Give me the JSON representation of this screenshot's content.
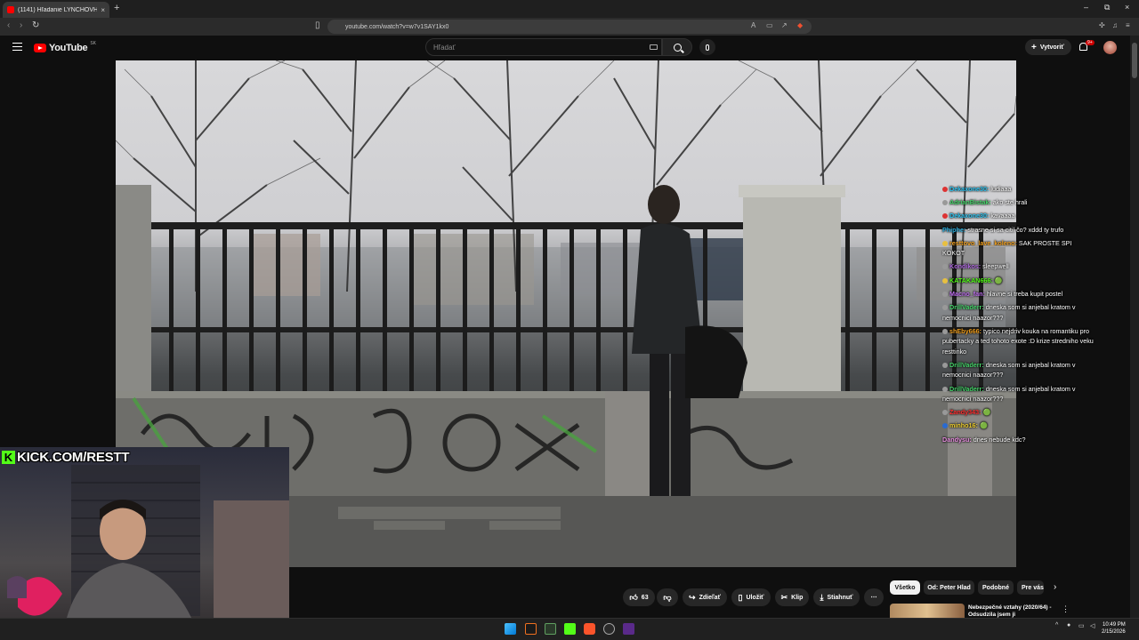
{
  "browser": {
    "tab_title": "(1141) Hľadanie LYNCHOVHO",
    "tab_close": "×",
    "new_tab": "+",
    "url": "youtube.com/watch?v=w7v1SAY1kx0",
    "window_controls": [
      "–",
      "⧉",
      "×"
    ]
  },
  "youtube": {
    "logo_text": "YouTube",
    "country_code": "SK",
    "search_placeholder": "Hľadať",
    "create_label": "Vytvoriť",
    "notif_badge": "9+"
  },
  "chat": [
    {
      "user": "Dekaxone30:",
      "text": "ludiaaa",
      "color": "#2ec4f1",
      "badge": "#d33"
    },
    {
      "user": "AdrianBistak:",
      "text": "ako ste hrali",
      "color": "#46d46a",
      "badge": "#999"
    },
    {
      "user": "Dekaxone30:",
      "text": "kavaaaa",
      "color": "#2ec4f1",
      "badge": "#d33"
    },
    {
      "user": "Phiphe:",
      "text": "strasne si sa citil čo? xddd ty trufo",
      "color": "#30b0e0",
      "badge": ""
    },
    {
      "user": "resttovo_lave_koleno:",
      "text": "SAK PROSTE SPI KOKOT",
      "color": "#f0a020",
      "badge": "#e8c040"
    },
    {
      "user": "Kondikos:",
      "text": "sleepwell",
      "color": "#b06ae0",
      "badge": "#999"
    },
    {
      "user": "KATAKAN666:",
      "text": "🟢",
      "color": "#53fc18",
      "badge": "#e8c040"
    },
    {
      "user": "Macno_fan:",
      "text": "hlavne si treba kupit postel",
      "color": "#c070f0",
      "badge": "#999"
    },
    {
      "user": "DrillVaderr:",
      "text": "dneska som si anjebal kratom v nemocnici naazor???",
      "color": "#46d46a",
      "badge": "#999"
    },
    {
      "user": "shEby666:",
      "text": "typico nejdriv kouka na romantiku pro pubertacky a ted tohoto exote :D krize stredniho veku resttinko",
      "color": "#f0a020",
      "badge": "#999"
    },
    {
      "user": "DrillVaderr:",
      "text": "dneska som si anjebal kratom v nemocnici naazor???",
      "color": "#46d46a",
      "badge": "#999"
    },
    {
      "user": "DrillVaderr:",
      "text": "dneska som si anjebal kratom v nemocnici naazor???",
      "color": "#46d46a",
      "badge": "#999"
    },
    {
      "user": "Zandy343:",
      "text": "🟢",
      "color": "#ff3030",
      "badge": "#999"
    },
    {
      "user": "minho16:",
      "text": "🟢",
      "color": "#f0d030",
      "badge": "#2a6ad0"
    },
    {
      "user": "Dandysu:",
      "text": "dnes nebude kdc?",
      "color": "#e890e0",
      "badge": ""
    }
  ],
  "overlay": {
    "kick_letter": "K",
    "kick_text": "KICK.COM/RESTT"
  },
  "actions": {
    "like_count": "63",
    "share": "Zdieľať",
    "save": "Uložiť",
    "clip": "Klip",
    "download": "Stiahnuť",
    "more": "⋯"
  },
  "chips": [
    "Všetko",
    "Od: Peter Hlad",
    "Podobné",
    "Pre vás"
  ],
  "recommendation": {
    "title": "Nebezpečné vztahy (2020/64) - Odsudzila jsem ji"
  },
  "clock": {
    "time": "10:49 PM",
    "date": "2/15/2026"
  }
}
